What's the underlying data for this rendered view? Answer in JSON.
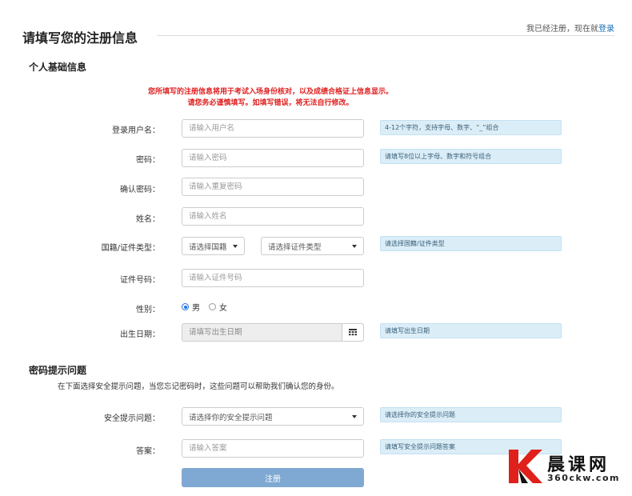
{
  "header": {
    "title": "请填写您的注册信息",
    "login_prefix": "我已经注册，现在就",
    "login_link": "登录"
  },
  "section_personal": {
    "title": "个人基础信息",
    "notice_line1": "您所填写的注册信息将用于考试入场身份核对，以及成绩合格证上信息显示。",
    "notice_line2": "请您务必谨慎填写。如填写错误，将无法自行修改。"
  },
  "fields": {
    "username": {
      "label": "登录用户名：",
      "placeholder": "请输入用户名",
      "tip": "4-12个字符，支持字母、数字、“_”组合"
    },
    "password": {
      "label": "密码：",
      "placeholder": "请输入密码",
      "tip": "请填写8位以上字母、数字和符号组合"
    },
    "confirm_password": {
      "label": "确认密码：",
      "placeholder": "请输入重复密码"
    },
    "name": {
      "label": "姓名：",
      "placeholder": "请输入姓名"
    },
    "nationality_id": {
      "label": "国籍/证件类型：",
      "country_select": "请选择国籍",
      "id_type_select": "请选择证件类型",
      "tip": "请选择国籍/证件类型"
    },
    "id_number": {
      "label": "证件号码：",
      "placeholder": "请输入证件号码"
    },
    "gender": {
      "label": "性别：",
      "male": "男",
      "female": "女",
      "selected": "男"
    },
    "birth_date": {
      "label": "出生日期：",
      "placeholder": "请填写出生日期",
      "tip": "请填写出生日期"
    }
  },
  "section_security": {
    "title": "密码提示问题",
    "note": "在下面选择安全提示问题，当您忘记密码时，这些问题可以帮助我们确认您的身份。"
  },
  "security": {
    "question": {
      "label": "安全提示问题：",
      "select": "请选择你的安全提示问题",
      "tip": "请选择你的安全提示问题"
    },
    "answer": {
      "label": "答案：",
      "placeholder": "请输入答案",
      "tip": "请填写安全提示问题答案"
    }
  },
  "submit_label": "注册",
  "watermark": {
    "name": "晨课网",
    "url": "360ckw.com"
  },
  "colors": {
    "accent": "#1a6fb5",
    "notice": "#e02020",
    "tip_bg": "#dbeef8",
    "submit_bg": "#7fa9d2"
  }
}
